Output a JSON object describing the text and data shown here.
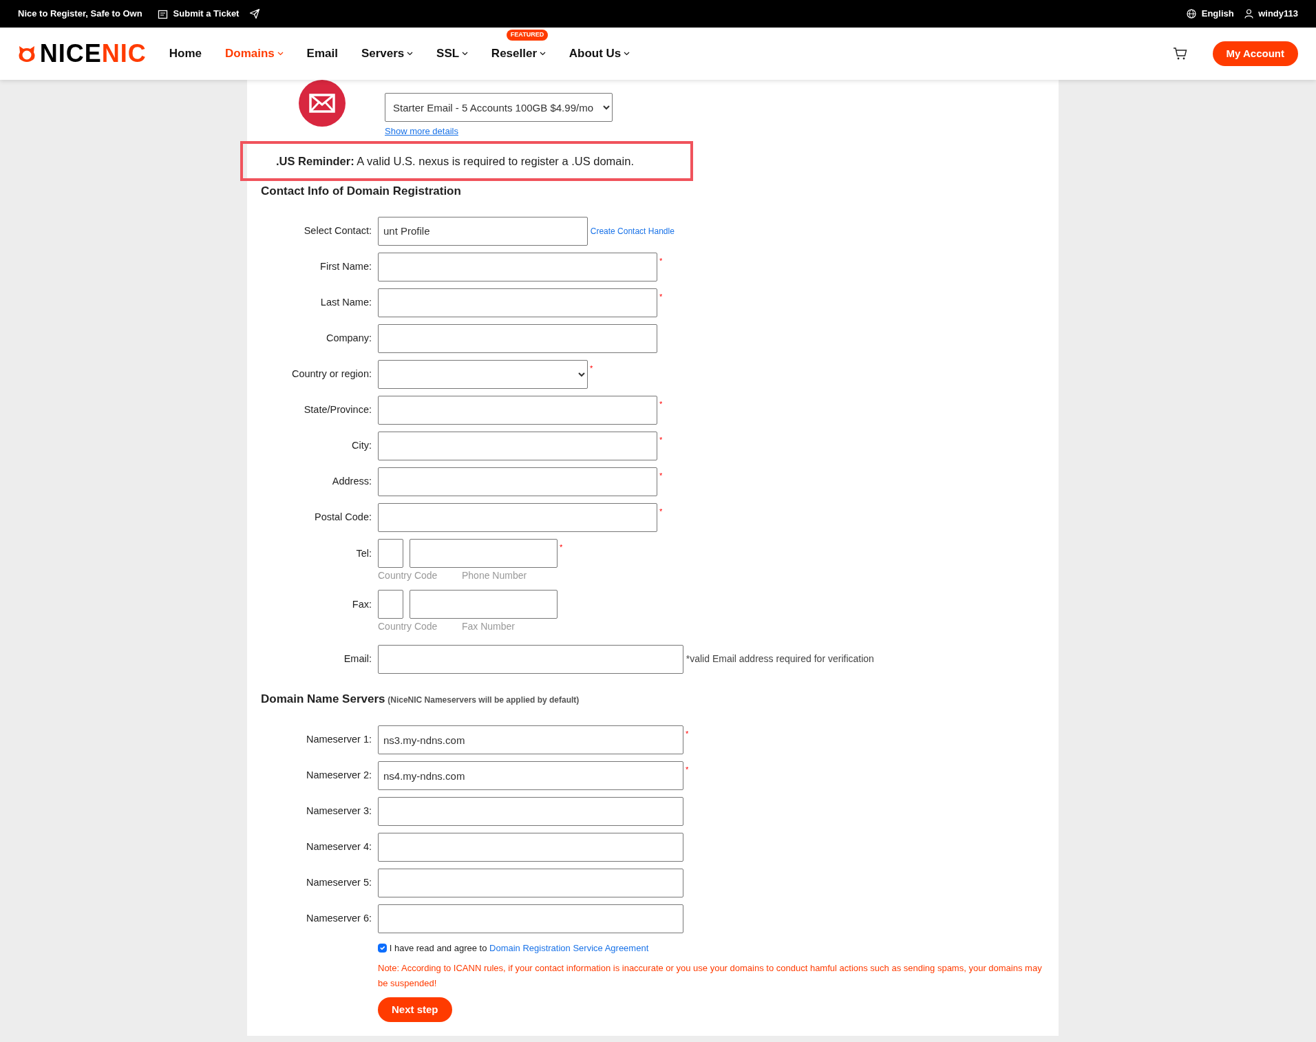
{
  "topbar": {
    "tagline": "Nice to Register, Safe to Own",
    "ticket": "Submit a Ticket",
    "language": "English",
    "user": "windy113"
  },
  "nav": {
    "logo": {
      "dark": "NICE",
      "accent": "NIC"
    },
    "items": [
      {
        "label": "Home",
        "selected": false,
        "dropdown": false
      },
      {
        "label": "Domains",
        "selected": true,
        "dropdown": true
      },
      {
        "label": "Email",
        "selected": false,
        "dropdown": false
      },
      {
        "label": "Servers",
        "selected": false,
        "dropdown": true
      },
      {
        "label": "SSL",
        "selected": false,
        "dropdown": true
      },
      {
        "label": "Reseller",
        "selected": false,
        "dropdown": true,
        "badge": "FEATURED"
      },
      {
        "label": "About Us",
        "selected": false,
        "dropdown": true
      }
    ],
    "account_button": "My Account"
  },
  "email_addon": {
    "plan": "Starter Email - 5 Accounts 100GB $4.99/mo",
    "details_link": "Show more details"
  },
  "reminder": {
    "label": ".US Reminder:",
    "text": "A valid U.S. nexus is required to register a .US domain."
  },
  "contact": {
    "title": "Contact Info of Domain Registration",
    "fields": [
      {
        "kind": "lookup",
        "label": "Select Contact:",
        "value": "unt Profile",
        "link": "Create Contact Handle",
        "required": false
      },
      {
        "kind": "text",
        "label": "First Name:",
        "required": true
      },
      {
        "kind": "text",
        "label": "Last Name:",
        "required": true
      },
      {
        "kind": "text",
        "label": "Company:",
        "required": false
      },
      {
        "kind": "select",
        "label": "Country or region:",
        "required": true
      },
      {
        "kind": "text",
        "label": "State/Province:",
        "required": true
      },
      {
        "kind": "text",
        "label": "City:",
        "required": true
      },
      {
        "kind": "text",
        "label": "Address:",
        "required": true
      },
      {
        "kind": "text",
        "label": "Postal Code:",
        "required": true
      },
      {
        "kind": "phone",
        "label": "Tel:",
        "hints": [
          "Country Code",
          "Phone Number"
        ],
        "required": true
      },
      {
        "kind": "phone",
        "label": "Fax:",
        "hints": [
          "Country Code",
          "Fax Number"
        ],
        "required": false
      },
      {
        "kind": "email",
        "label": "Email:",
        "note": "*valid Email address required for verification",
        "required": false
      }
    ]
  },
  "nameservers": {
    "title": "Domain Name Servers",
    "subtitle": "(NiceNIC Nameservers will be applied by default)",
    "fields": [
      {
        "label": "Nameserver 1:",
        "value": "ns3.my-ndns.com",
        "required": true
      },
      {
        "label": "Nameserver 2:",
        "value": "ns4.my-ndns.com",
        "required": true
      },
      {
        "label": "Nameserver 3:",
        "required": false
      },
      {
        "label": "Nameserver 4:",
        "required": false
      },
      {
        "label": "Nameserver 5:",
        "required": false
      },
      {
        "label": "Nameserver 6:",
        "required": false
      }
    ]
  },
  "agreement": {
    "checked": true,
    "text": "I have read and agree to",
    "link": "Domain Registration Service Agreement"
  },
  "note": "Note: According to ICANN rules, if your contact information is inaccurate or you use your domains to conduct hamful actions such as sending spams, your domains may be suspended!",
  "next_button": "Next step",
  "required_mark": "*"
}
